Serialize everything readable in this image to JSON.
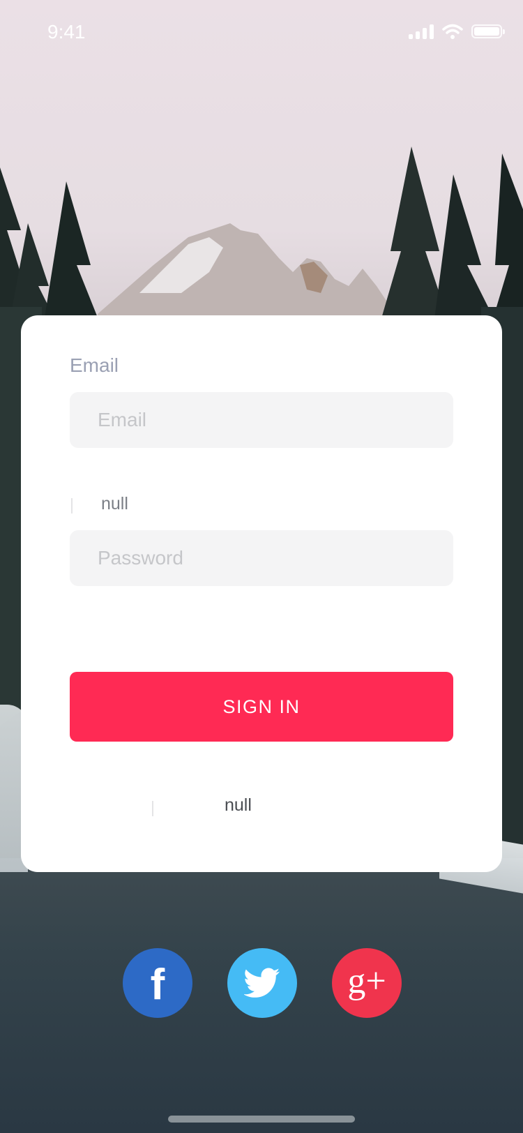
{
  "status_bar": {
    "time": "9:41"
  },
  "login_card": {
    "email_label": "Email",
    "email_placeholder": "Email",
    "password_label": "null",
    "password_placeholder": "Password",
    "sign_in_label": "SIGN IN",
    "footer_text": "null"
  },
  "social": {
    "facebook": {
      "glyph": "f",
      "color": "#2d6ac6",
      "icon": "facebook-icon"
    },
    "twitter": {
      "color": "#45bbf5",
      "icon": "twitter-icon"
    },
    "google_plus": {
      "glyph": "g+",
      "color": "#f0344d",
      "icon": "google-plus-icon"
    }
  },
  "colors": {
    "accent": "#ff2a54",
    "label": "#9aa0b3"
  }
}
